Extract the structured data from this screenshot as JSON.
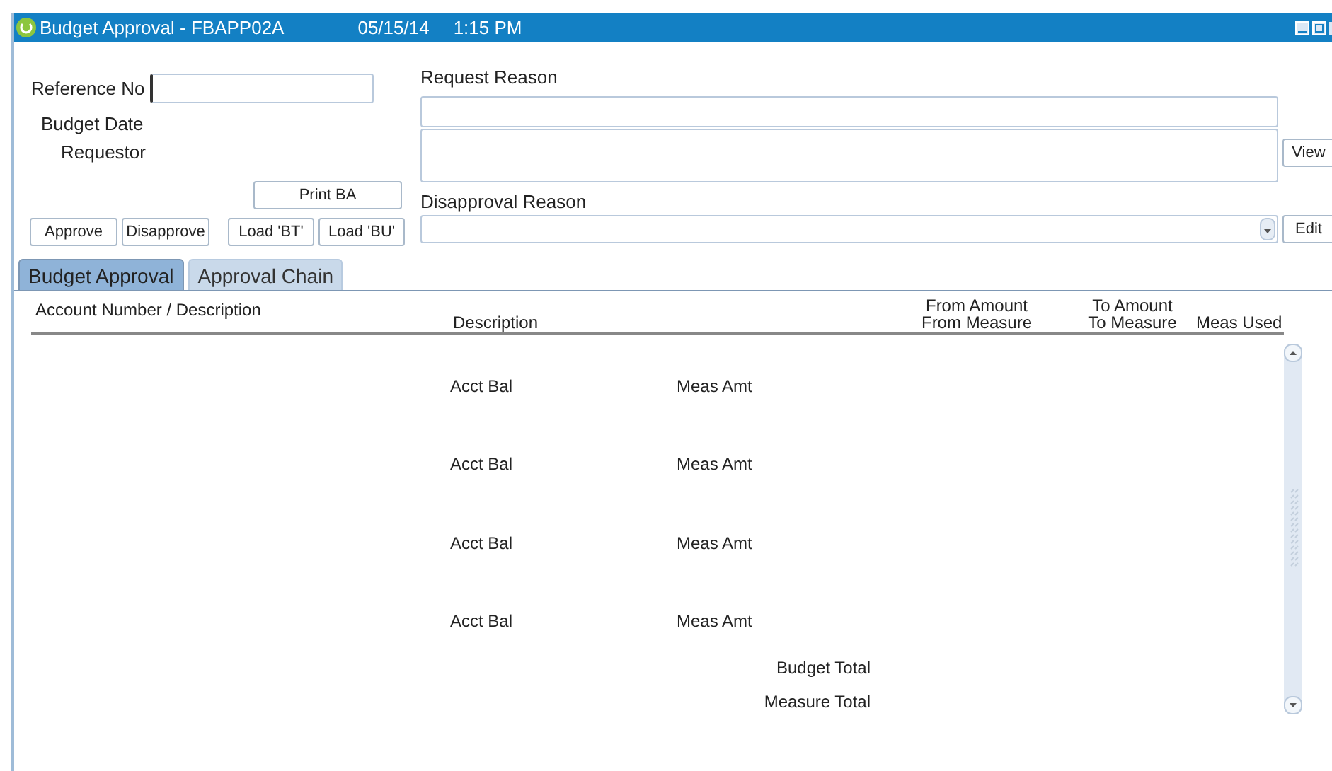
{
  "window": {
    "title": "Budget Approval - FBAPP02A",
    "date": "05/15/14",
    "time": "1:15 PM"
  },
  "form": {
    "reference_label": "Reference No",
    "budget_date_label": "Budget Date",
    "requestor_label": "Requestor",
    "request_reason_label": "Request Reason",
    "disapproval_reason_label": "Disapproval Reason",
    "view_button": "View",
    "edit_button": "Edit",
    "print_button": "Print BA"
  },
  "action_buttons": [
    "Approve",
    "Disapprove",
    "Load 'BT'",
    "Load 'BU'"
  ],
  "tabs": [
    {
      "label": "Budget Approval",
      "selected": true
    },
    {
      "label": "Approval Chain",
      "selected": false
    }
  ],
  "table": {
    "columns": [
      "Account Number / Description",
      "Description",
      "From Amount",
      "From Measure",
      "To Amount",
      "To Measure",
      "Meas Used"
    ],
    "rows": [
      {
        "balance_label": "Acct Bal",
        "measure_label": "Meas Amt"
      },
      {
        "balance_label": "Acct Bal",
        "measure_label": "Meas Amt"
      },
      {
        "balance_label": "Acct Bal",
        "measure_label": "Meas Amt"
      },
      {
        "balance_label": "Acct Bal",
        "measure_label": "Meas Amt"
      }
    ],
    "totals": [
      "Budget Total",
      "Measure Total"
    ]
  }
}
